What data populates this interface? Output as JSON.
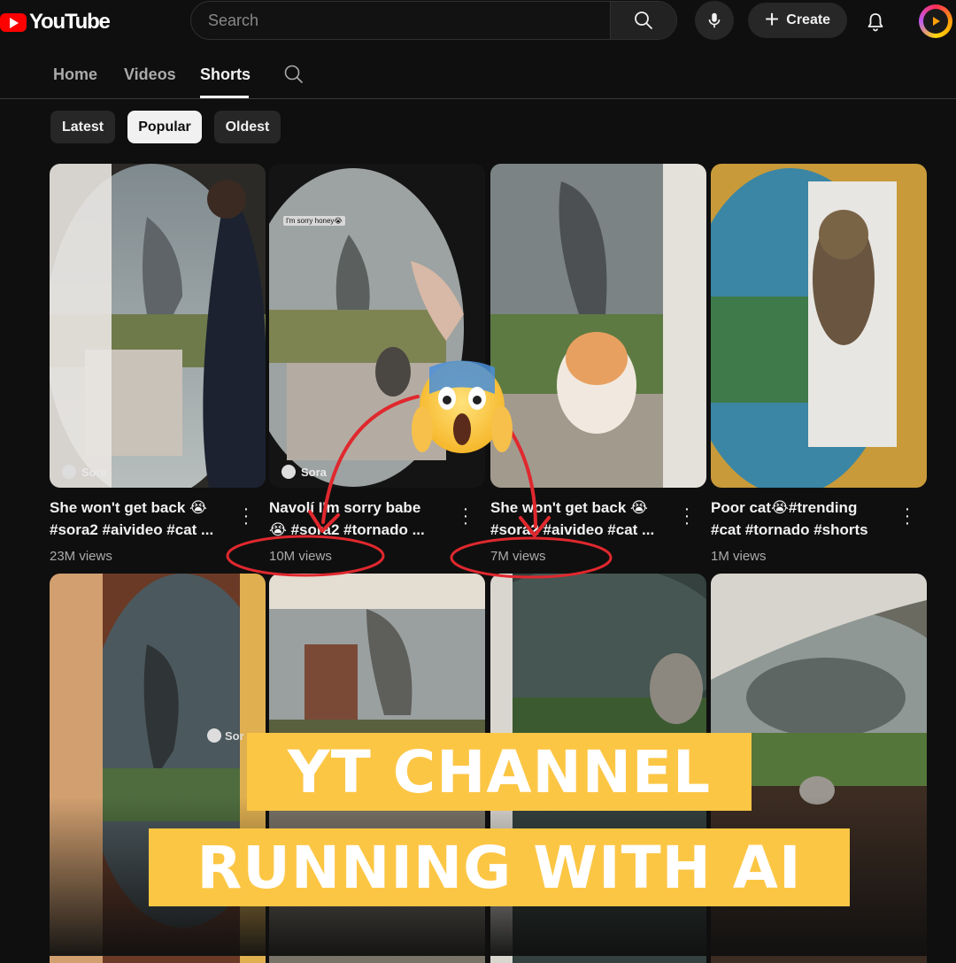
{
  "header": {
    "logo_text": "YouTube",
    "search_placeholder": "Search",
    "create_label": "Create"
  },
  "tabs": [
    {
      "label": "Home",
      "active": false
    },
    {
      "label": "Videos",
      "active": false
    },
    {
      "label": "Shorts",
      "active": true
    }
  ],
  "chips": [
    {
      "label": "Latest",
      "active": false
    },
    {
      "label": "Popular",
      "active": true
    },
    {
      "label": "Oldest",
      "active": false
    }
  ],
  "shorts": [
    {
      "title_line1": "She won't get back 😭",
      "title_line2": "#sora2 #aivideo #cat ...",
      "views": "23M views",
      "watermark": "Sora"
    },
    {
      "title_line1": "Navolí I'm sorry babe",
      "title_line2": "😭 #sora2 #tornado ...",
      "views": "10M views",
      "watermark": "Sora",
      "caption": "I'm sorry honey😭"
    },
    {
      "title_line1": "She won't get back 😭",
      "title_line2": "#sora2 #aivideo #cat ...",
      "views": "7M views"
    },
    {
      "title_line1": "Poor cat😭#trending",
      "title_line2": "#cat #tornado #shorts",
      "views": "1M views"
    }
  ],
  "second_row_watermark": "Sor",
  "banner": {
    "line1": "YT CHANNEL",
    "line2": "RUNNING WITH AI"
  },
  "colors": {
    "background": "#0f0f0f",
    "brand_red": "#ff0000",
    "banner_yellow": "#fcc645",
    "annotation_red": "#e0282e"
  },
  "icons": [
    "youtube-logo-icon",
    "search-icon",
    "mic-icon",
    "plus-icon",
    "bell-icon",
    "channel-avatar-icon",
    "more-vert-icon",
    "sora-logo-icon",
    "screaming-face-emoji"
  ]
}
